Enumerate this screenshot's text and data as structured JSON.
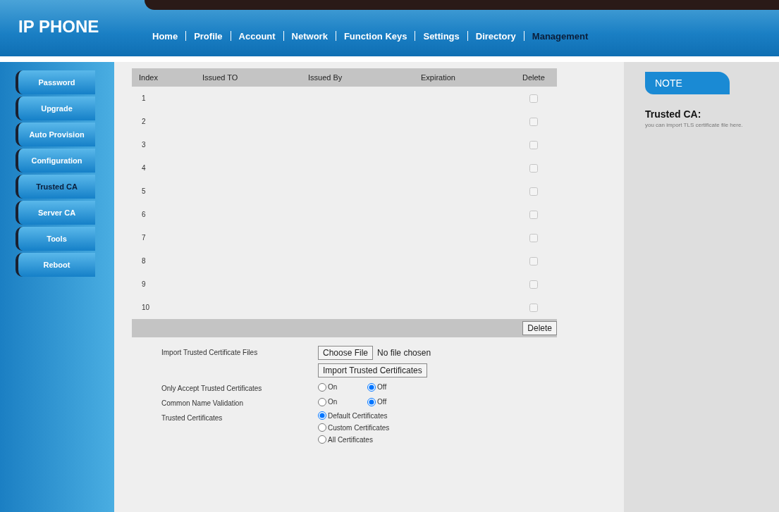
{
  "header": {
    "logo": "IP PHONE",
    "nav": [
      {
        "label": "Home",
        "selected": false
      },
      {
        "label": "Profile",
        "selected": false
      },
      {
        "label": "Account",
        "selected": false
      },
      {
        "label": "Network",
        "selected": false
      },
      {
        "label": "Function Keys",
        "selected": false
      },
      {
        "label": "Settings",
        "selected": false
      },
      {
        "label": "Directory",
        "selected": false
      },
      {
        "label": "Management",
        "selected": true
      }
    ]
  },
  "sidebar": {
    "items": [
      {
        "label": "Password",
        "selected": false
      },
      {
        "label": "Upgrade",
        "selected": false
      },
      {
        "label": "Auto Provision",
        "selected": false
      },
      {
        "label": "Configuration",
        "selected": false
      },
      {
        "label": "Trusted CA",
        "selected": true
      },
      {
        "label": "Server CA",
        "selected": false
      },
      {
        "label": "Tools",
        "selected": false
      },
      {
        "label": "Reboot",
        "selected": false
      }
    ]
  },
  "table": {
    "columns": [
      "Index",
      "Issued TO",
      "Issued By",
      "Expiration",
      "Delete"
    ],
    "rows": [
      {
        "index": "1",
        "checked": false
      },
      {
        "index": "2",
        "checked": false
      },
      {
        "index": "3",
        "checked": false
      },
      {
        "index": "4",
        "checked": false
      },
      {
        "index": "5",
        "checked": false
      },
      {
        "index": "6",
        "checked": false
      },
      {
        "index": "7",
        "checked": false
      },
      {
        "index": "8",
        "checked": false
      },
      {
        "index": "9",
        "checked": false
      },
      {
        "index": "10",
        "checked": false
      }
    ],
    "delete_button": "Delete"
  },
  "form": [
    {
      "kind": "file",
      "label": "Import Trusted Certificate Files",
      "button": "Choose File",
      "status": "No file chosen",
      "action": "Import Trusted Certificates"
    },
    {
      "kind": "radio",
      "label": "Only Accept Trusted Certificates",
      "options": [
        {
          "label": "On",
          "selected": false
        },
        {
          "label": "Off",
          "selected": true
        }
      ]
    },
    {
      "kind": "radio",
      "label": "Common Name Validation",
      "options": [
        {
          "label": "On",
          "selected": false
        },
        {
          "label": "Off",
          "selected": true
        }
      ]
    },
    {
      "kind": "stack",
      "label": "Trusted Certificates",
      "options": [
        {
          "label": "Default Certificates",
          "selected": true
        },
        {
          "label": "Custom Certificates",
          "selected": false
        },
        {
          "label": "All Certificates",
          "selected": false
        }
      ]
    }
  ],
  "note": {
    "tab": "NOTE",
    "title": "Trusted CA:",
    "text": "you can import TLS certificate file here."
  }
}
